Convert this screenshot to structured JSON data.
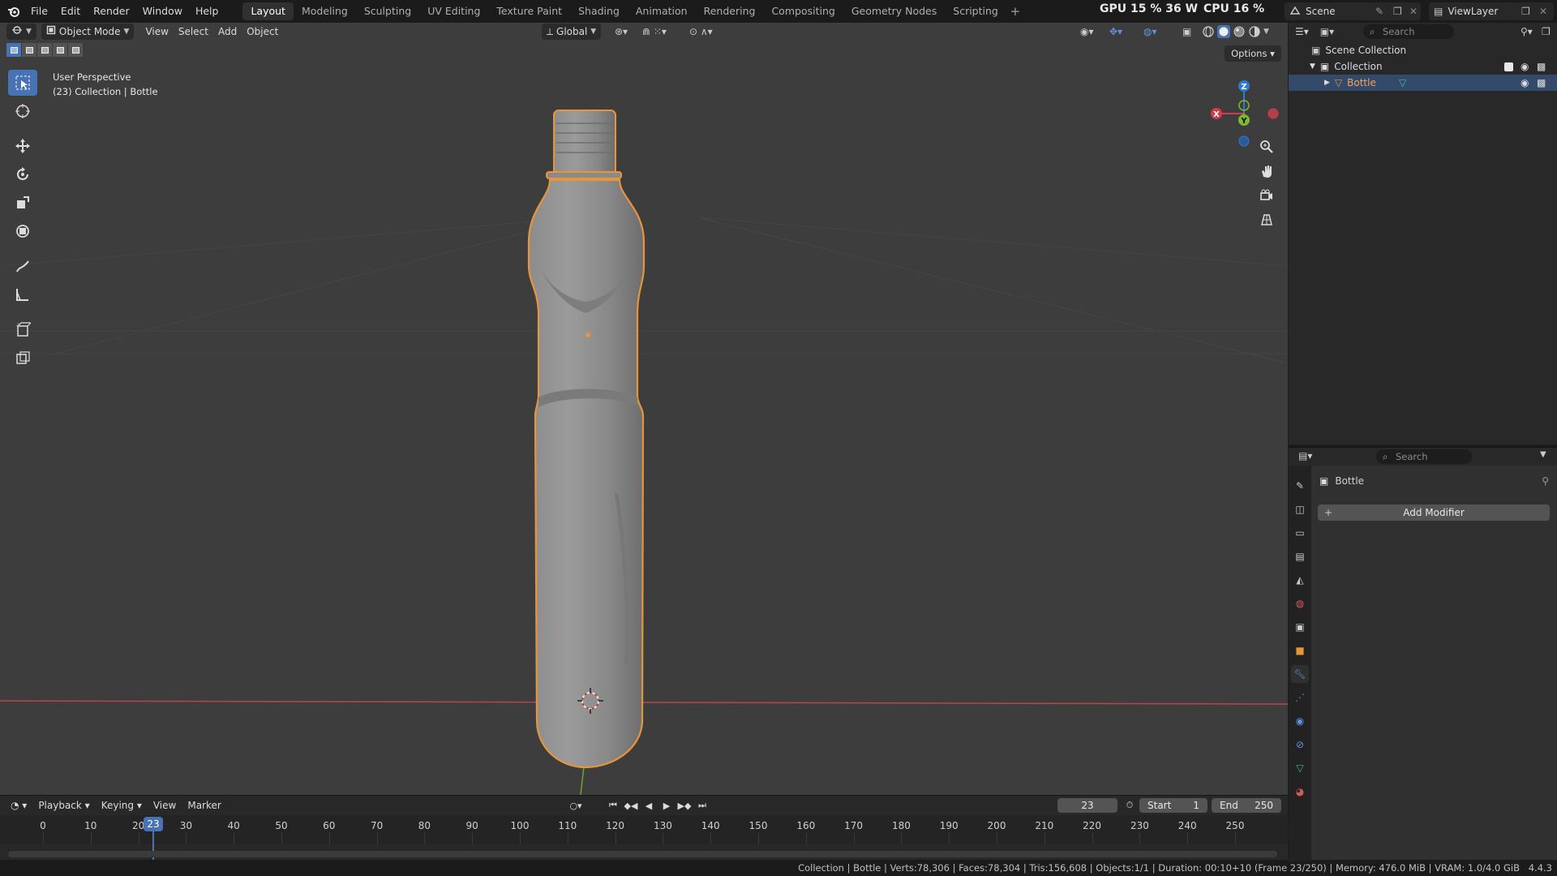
{
  "menubar": {
    "items": [
      "File",
      "Edit",
      "Render",
      "Window",
      "Help"
    ]
  },
  "workspaces": [
    "Layout",
    "Modeling",
    "Sculpting",
    "UV Editing",
    "Texture Paint",
    "Shading",
    "Animation",
    "Rendering",
    "Compositing",
    "Geometry Nodes",
    "Scripting"
  ],
  "active_workspace": "Layout",
  "perf": {
    "gpu": "GPU 15 % 36 W",
    "cpu": "CPU 16 %"
  },
  "scene": {
    "scene_name": "Scene",
    "view_layer": "ViewLayer"
  },
  "viewport": {
    "mode": "Object Mode",
    "menus": [
      "View",
      "Select",
      "Add",
      "Object"
    ],
    "orientation": "Global",
    "options_label": "Options",
    "info_line1": "User Perspective",
    "info_line2": "(23) Collection | Bottle",
    "gizmo": {
      "z": "Z",
      "y": "Y",
      "x": "X"
    }
  },
  "outliner": {
    "search_placeholder": "Search",
    "scene_collection": "Scene Collection",
    "collection": "Collection",
    "object": "Bottle"
  },
  "properties": {
    "search_placeholder": "Search",
    "object_name": "Bottle",
    "add_modifier": "Add Modifier"
  },
  "timeline": {
    "menus": [
      "Playback",
      "Keying",
      "View",
      "Marker"
    ],
    "current_frame": "23",
    "start_label": "Start",
    "start": "1",
    "end_label": "End",
    "end": "250",
    "ticks": [
      "0",
      "10",
      "20",
      "30",
      "40",
      "50",
      "60",
      "70",
      "80",
      "90",
      "100",
      "110",
      "120",
      "130",
      "140",
      "150",
      "160",
      "170",
      "180",
      "190",
      "200",
      "210",
      "220",
      "230",
      "240",
      "250"
    ]
  },
  "statusbar": {
    "text": "Collection | Bottle | Verts:78,306 | Faces:78,304 | Tris:156,608 | Objects:1/1 | Duration: 00:10+10 (Frame 23/250) | Memory: 476.0 MiB | VRAM: 1.0/4.0 GiB",
    "version": "4.4.3"
  },
  "colors": {
    "selection_outline": "#e8953a",
    "accent": "#4772b3",
    "viewport_bg": "#3d3d3d",
    "axis_x": "#d23c4a",
    "axis_y": "#7cba2f",
    "axis_z": "#2f7ad6"
  }
}
